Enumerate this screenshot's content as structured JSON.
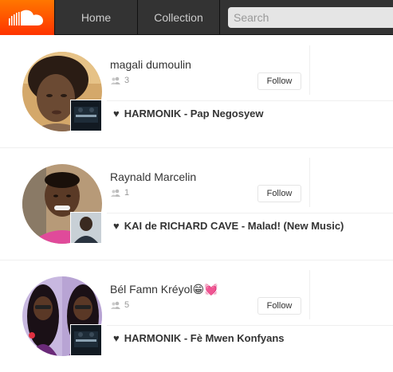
{
  "header": {
    "logo_icon": "soundcloud-logo-icon",
    "brand_color": "#ff5500",
    "nav": [
      {
        "label": "Home"
      },
      {
        "label": "Collection"
      }
    ],
    "search": {
      "placeholder": "Search",
      "value": ""
    }
  },
  "feed": [
    {
      "username": "magali dumoulin",
      "followers": "3",
      "follow_label": "Follow",
      "track": "HARMONIK - Pap Negosyew",
      "avatar_icon": "user-avatar",
      "artwork_icon": "track-artwork"
    },
    {
      "username": "Raynald Marcelin",
      "followers": "1",
      "follow_label": "Follow",
      "track": "KAI de RICHARD CAVE - Malad! (New Music)",
      "avatar_icon": "user-avatar",
      "artwork_icon": "track-artwork"
    },
    {
      "username": "Bél Famn Kréyol😁💓",
      "followers": "5",
      "follow_label": "Follow",
      "track": "HARMONIK - Fè Mwen Konfyans",
      "avatar_icon": "user-avatar",
      "artwork_icon": "track-artwork"
    }
  ]
}
